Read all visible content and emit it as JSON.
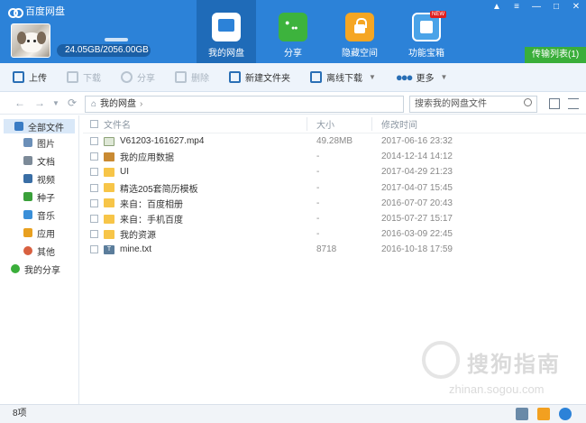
{
  "app": {
    "title": "百度网盘"
  },
  "user": {
    "quota": "24.05GB/2056.00GB"
  },
  "nav_tabs": [
    {
      "label": "我的网盘",
      "icon": "disk-icon",
      "active": true
    },
    {
      "label": "分享",
      "icon": "share-icon",
      "active": false
    },
    {
      "label": "隐藏空间",
      "icon": "lock-icon",
      "active": false
    },
    {
      "label": "功能宝箱",
      "icon": "toolbox-icon",
      "active": false,
      "badge": "NEW"
    }
  ],
  "window_buttons": [
    "▲",
    "≡",
    "—",
    "□",
    "✕"
  ],
  "transfer_button": "传输列表(1)",
  "toolbar": {
    "upload": "上传",
    "download": "下载",
    "share": "分享",
    "delete": "删除",
    "new_folder": "新建文件夹",
    "offline_download": "离线下载",
    "more": "更多"
  },
  "address": {
    "path": "我的网盘",
    "separator": "›"
  },
  "search": {
    "placeholder": "搜索我的网盘文件"
  },
  "sidebar": {
    "root": "全部文件",
    "items": [
      {
        "label": "图片",
        "icon": "image-icon",
        "color": "#6b8fb8"
      },
      {
        "label": "文档",
        "icon": "document-icon",
        "color": "#7c8a98"
      },
      {
        "label": "视频",
        "icon": "video-icon",
        "color": "#3a6ea5"
      },
      {
        "label": "种子",
        "icon": "bt-icon",
        "color": "#3aa03a"
      },
      {
        "label": "音乐",
        "icon": "music-icon",
        "color": "#3a8fd8"
      },
      {
        "label": "应用",
        "icon": "app-icon",
        "color": "#e8a020"
      },
      {
        "label": "其他",
        "icon": "other-icon",
        "color": "#d86040"
      }
    ],
    "share": "我的分享"
  },
  "list": {
    "columns": {
      "name": "文件名",
      "size": "大小",
      "date": "修改时间"
    },
    "rows": [
      {
        "name": "V61203-161627.mp4",
        "size": "49.28MB",
        "date": "2017-06-16 23:32",
        "icon": "video"
      },
      {
        "name": "我的应用数据",
        "size": "-",
        "date": "2014-12-14 14:12",
        "icon": "app"
      },
      {
        "name": "UI",
        "size": "-",
        "date": "2017-04-29 21:23",
        "icon": "folder"
      },
      {
        "name": "精选205套简历模板",
        "size": "-",
        "date": "2017-04-07 15:45",
        "icon": "folder"
      },
      {
        "name": "来自：百度相册",
        "size": "-",
        "date": "2016-07-07 20:43",
        "icon": "folder"
      },
      {
        "name": "来自：手机百度",
        "size": "-",
        "date": "2015-07-27 15:17",
        "icon": "folder"
      },
      {
        "name": "我的资源",
        "size": "-",
        "date": "2016-03-09 22:45",
        "icon": "folder"
      },
      {
        "name": "mine.txt",
        "size": "8718",
        "date": "2016-10-18 17:59",
        "icon": "txt"
      }
    ]
  },
  "status": {
    "count": "8项"
  },
  "watermark": {
    "text": "搜狗指南",
    "url": "zhinan.sogou.com"
  }
}
